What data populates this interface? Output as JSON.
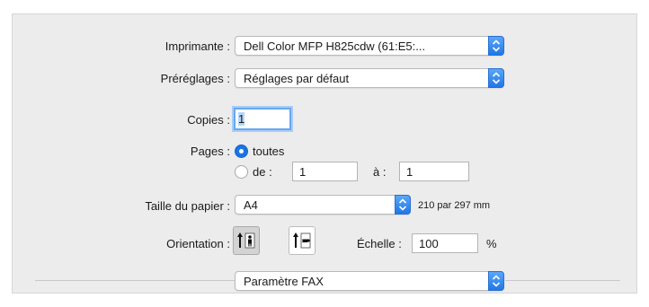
{
  "printer": {
    "label": "Imprimante :",
    "value": "Dell Color MFP H825cdw (61:E5:..."
  },
  "presets": {
    "label": "Préréglages :",
    "value": "Réglages par défaut"
  },
  "copies": {
    "label": "Copies :",
    "value": "1"
  },
  "pages": {
    "label": "Pages :",
    "all_label": "toutes",
    "from_label": "de :",
    "from_value": "1",
    "to_label": "à :",
    "to_value": "1",
    "selected": "toutes"
  },
  "paper": {
    "label": "Taille du papier :",
    "value": "A4",
    "dimensions": "210 par 297 mm"
  },
  "orientation": {
    "label": "Orientation :",
    "selected": "portrait",
    "options": [
      "portrait-icon",
      "landscape-icon"
    ]
  },
  "scale": {
    "label": "Échelle :",
    "value": "100",
    "unit": "%"
  },
  "section": {
    "value": "Paramètre FAX"
  },
  "colors": {
    "accent": "#1b74e4",
    "panel": "#ececec"
  }
}
